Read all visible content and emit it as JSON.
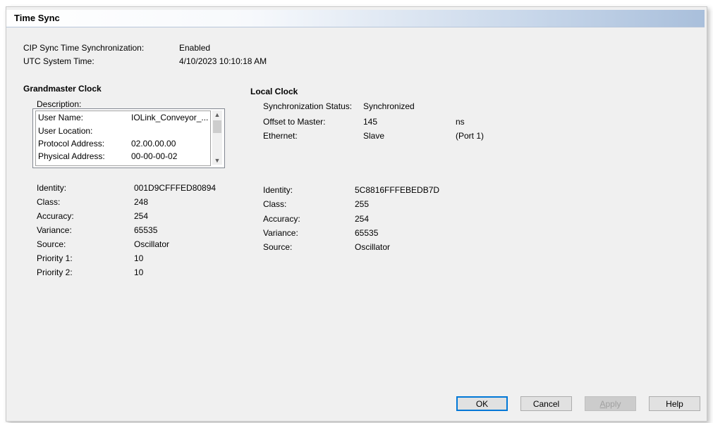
{
  "window": {
    "title": "Time Sync"
  },
  "summary": {
    "cip_sync_label": "CIP Sync Time Synchronization:",
    "cip_sync_value": "Enabled",
    "utc_label": "UTC System Time:",
    "utc_value": "4/10/2023 10:10:18 AM"
  },
  "grandmaster": {
    "heading": "Grandmaster Clock",
    "description_label": "Description:",
    "description_rows": [
      {
        "key": "User Name:",
        "value": "IOLink_Conveyor_..."
      },
      {
        "key": "User Location:",
        "value": ""
      },
      {
        "key": "Protocol Address:",
        "value": "02.00.00.00"
      },
      {
        "key": "Physical Address:",
        "value": "00-00-00-02"
      }
    ],
    "fields": [
      {
        "key": "Identity:",
        "value": "001D9CFFFED80894"
      },
      {
        "key": "Class:",
        "value": "248"
      },
      {
        "key": "Accuracy:",
        "value": "254"
      },
      {
        "key": "Variance:",
        "value": "65535"
      },
      {
        "key": "Source:",
        "value": "Oscillator"
      },
      {
        "key": "Priority 1:",
        "value": "10"
      },
      {
        "key": "Priority 2:",
        "value": "10"
      }
    ]
  },
  "local": {
    "heading": "Local Clock",
    "status_label": "Synchronization Status:",
    "status_value": "Synchronized",
    "offset_label": "Offset to Master:",
    "offset_value": "145",
    "offset_unit": "ns",
    "ethernet_label": "Ethernet:",
    "ethernet_value": "Slave",
    "ethernet_port": "(Port 1)",
    "fields": [
      {
        "key": "Identity:",
        "value": "5C8816FFFEBEDB7D"
      },
      {
        "key": "Class:",
        "value": "255"
      },
      {
        "key": "Accuracy:",
        "value": "254"
      },
      {
        "key": "Variance:",
        "value": "65535"
      },
      {
        "key": "Source:",
        "value": "Oscillator"
      }
    ]
  },
  "buttons": {
    "ok": "OK",
    "cancel": "Cancel",
    "apply_prefix": "A",
    "apply_rest": "pply",
    "help": "Help"
  },
  "icons": {
    "scroll_up": "chevron-up-icon",
    "scroll_down": "chevron-down-icon"
  }
}
